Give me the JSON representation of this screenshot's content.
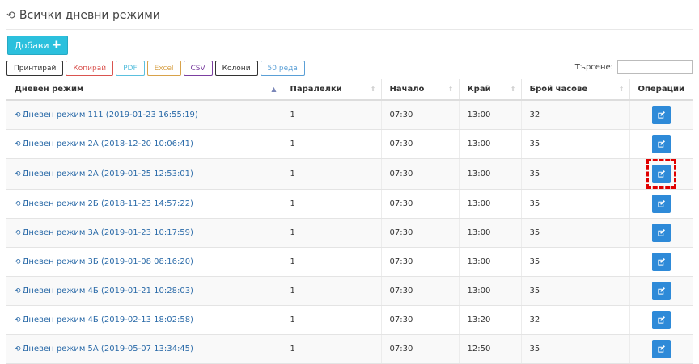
{
  "title": "Всички дневни режими",
  "add_button": "Добави",
  "toolbar": [
    "Принтирай",
    "Копирай",
    "PDF",
    "Excel",
    "CSV",
    "Колони",
    "50 реда"
  ],
  "toolbar_colors": [
    "#333333",
    "#d9534f",
    "#5bc0de",
    "#d8a24a",
    "#7b3fa0",
    "#333333",
    "#5a9fd6"
  ],
  "search": {
    "label": "Търсене:",
    "value": ""
  },
  "columns": [
    "Дневен режим",
    "Паралелки",
    "Начало",
    "Край",
    "Брой часове",
    "Операции"
  ],
  "rows": [
    {
      "name": "Дневен режим 111 (2019-01-23 16:55:19)",
      "paralelki": "1",
      "start": "07:30",
      "end": "13:00",
      "hours": "32"
    },
    {
      "name": "Дневен режим 2А (2018-12-20 10:06:41)",
      "paralelki": "1",
      "start": "07:30",
      "end": "13:00",
      "hours": "35"
    },
    {
      "name": "Дневен режим 2А (2019-01-25 12:53:01)",
      "paralelki": "1",
      "start": "07:30",
      "end": "13:00",
      "hours": "35"
    },
    {
      "name": "Дневен режим 2Б (2018-11-23 14:57:22)",
      "paralelki": "1",
      "start": "07:30",
      "end": "13:00",
      "hours": "35"
    },
    {
      "name": "Дневен режим 3А (2019-01-23 10:17:59)",
      "paralelki": "1",
      "start": "07:30",
      "end": "13:00",
      "hours": "35"
    },
    {
      "name": "Дневен режим 3Б (2019-01-08 08:16:20)",
      "paralelki": "1",
      "start": "07:30",
      "end": "13:00",
      "hours": "35"
    },
    {
      "name": "Дневен режим 4Б (2019-01-21 10:28:03)",
      "paralelki": "1",
      "start": "07:30",
      "end": "13:00",
      "hours": "35"
    },
    {
      "name": "Дневен режим 4Б (2019-02-13 18:02:58)",
      "paralelki": "1",
      "start": "07:30",
      "end": "13:20",
      "hours": "32"
    },
    {
      "name": "Дневен режим 5А (2019-05-07 13:34:45)",
      "paralelki": "1",
      "start": "07:30",
      "end": "12:50",
      "hours": "35"
    }
  ],
  "highlighted_row": 2,
  "colors": {
    "accent": "#2bc0dd",
    "edit_button": "#2e8ad8",
    "link": "#2a6aa8",
    "highlight": "#e00000"
  }
}
